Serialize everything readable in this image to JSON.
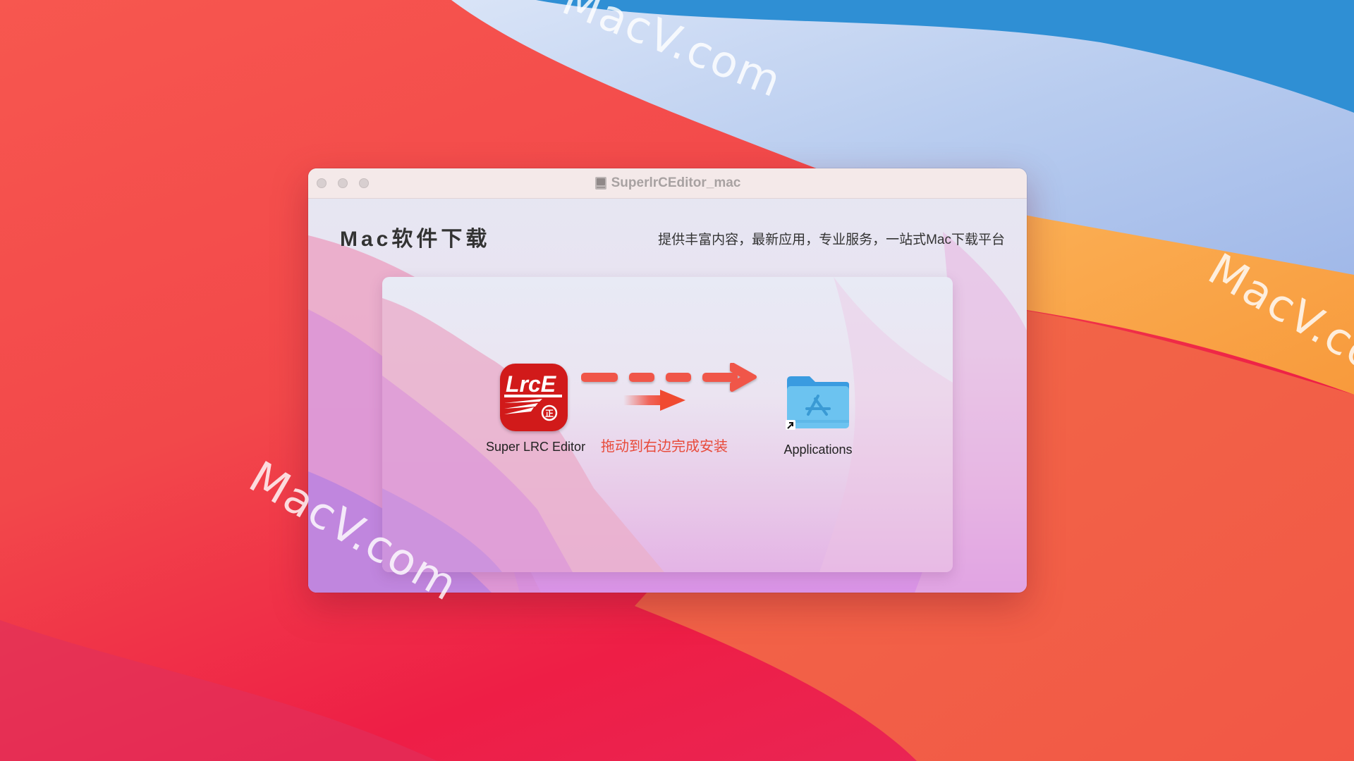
{
  "watermark": "MacV.com",
  "window": {
    "title": "SuperlrCEditor_mac",
    "traffic_lights": [
      "close",
      "minimize",
      "zoom"
    ]
  },
  "header": {
    "title": "Mac软件下载",
    "tagline": "提供丰富内容，最新应用，专业服务，一站式Mac下载平台"
  },
  "installer": {
    "app": {
      "name": "Super LRC Editor",
      "icon": "lrce-app-icon",
      "icon_text": "LrcE",
      "badge": "正"
    },
    "instruction": "拖动到右边完成安装",
    "target": {
      "name": "Applications",
      "icon": "applications-folder-icon"
    }
  },
  "colors": {
    "accent_arrow": "#f0574a",
    "instruction_text": "#e84a3a",
    "app_icon_red": "#d11a1a",
    "folder_blue": "#6cc3f0"
  }
}
